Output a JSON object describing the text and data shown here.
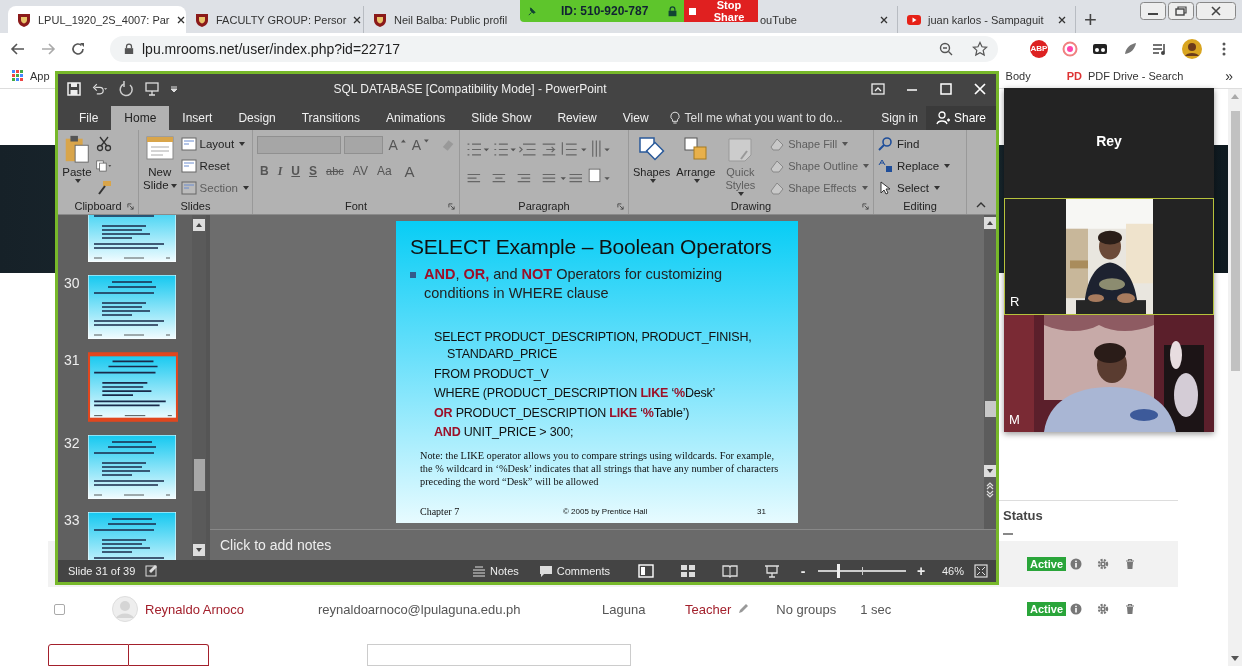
{
  "browser": {
    "tabs": [
      {
        "title": "LPUL_1920_2S_4007: Par",
        "selected": true
      },
      {
        "title": "FACULTY GROUP: Persor",
        "selected": false
      },
      {
        "title": "Neil Balba: Public profil",
        "selected": false
      },
      {
        "title": "ouTube",
        "selected": false
      },
      {
        "title": "juan karlos - Sampaguit",
        "selected": false
      }
    ],
    "new_tab": "+",
    "url": "lpu.mrooms.net/user/index.php?id=22717",
    "extension_badge": "ABP",
    "bookmarks": [
      "App",
      "Body",
      "PDF Drive - Search"
    ],
    "bookmark_badge": "PD",
    "bookmarks_more": "»"
  },
  "screen_share": {
    "meeting_id": "ID: 510-920-787",
    "stop": "Stop Share"
  },
  "powerpoint": {
    "title": "SQL DATABASE [Compatibility Mode] - PowerPoint",
    "tabs": [
      {
        "label": "File",
        "selected": false
      },
      {
        "label": "Home",
        "selected": true
      },
      {
        "label": "Insert",
        "selected": false
      },
      {
        "label": "Design",
        "selected": false
      },
      {
        "label": "Transitions",
        "selected": false
      },
      {
        "label": "Animations",
        "selected": false
      },
      {
        "label": "Slide Show",
        "selected": false
      },
      {
        "label": "Review",
        "selected": false
      },
      {
        "label": "View",
        "selected": false
      }
    ],
    "tell_me": "Tell me what you want to do...",
    "sign_in": "Sign in",
    "share": "Share",
    "ribbon": {
      "clipboard": {
        "label": "Clipboard",
        "paste": "Paste"
      },
      "slides": {
        "label": "Slides",
        "new_slide": [
          "New",
          "Slide"
        ],
        "items": [
          {
            "label": "Layout",
            "disabled": false
          },
          {
            "label": "Reset",
            "disabled": false
          },
          {
            "label": "Section",
            "disabled": true
          }
        ]
      },
      "font": {
        "label": "Font",
        "grow": "A",
        "shrink": "A",
        "buttons": [
          "B",
          "I",
          "U",
          "S",
          "abc",
          "AV",
          "Aa",
          "A"
        ]
      },
      "paragraph": {
        "label": "Paragraph"
      },
      "drawing": {
        "label": "Drawing",
        "large": [
          {
            "label": "Shapes",
            "disabled": false
          },
          {
            "label": "Arrange",
            "disabled": false
          },
          {
            "label": "Quick Styles",
            "disabled": true
          }
        ],
        "items": [
          {
            "label": "Shape Fill",
            "disabled": true
          },
          {
            "label": "Shape Outline",
            "disabled": true
          },
          {
            "label": "Shape Effects",
            "disabled": true
          }
        ]
      },
      "editing": {
        "label": "Editing",
        "items": [
          "Find",
          "Replace",
          "Select"
        ]
      }
    },
    "thumbnails": [
      {
        "selected": false
      },
      {
        "number": "30",
        "selected": false
      },
      {
        "number": "31",
        "selected": true
      },
      {
        "number": "32",
        "selected": false
      },
      {
        "number": "33",
        "selected": false
      }
    ],
    "slide": {
      "title": "SELECT Example – Boolean Operators",
      "bullet": "**AND**, **OR,** and **NOT** Operators for customizing conditions in WHERE clause",
      "code": [
        {
          "text": "SELECT PRODUCT_DESCRIPTION, PRODUCT_FINISH,",
          "indent": false
        },
        {
          "text": "STANDARD_PRICE",
          "indent": true
        },
        {
          "text": "FROM PRODUCT_V",
          "indent": false
        },
        {
          "text": "WHERE (PRODUCT_DESCRIPTION **LIKE** ‘**%**Desk’",
          "indent": false
        },
        {
          "text": "**OR** PRODUCT_DESCRIPTION **LIKE** ‘**%**Table’)",
          "indent": false
        },
        {
          "text": "**AND** UNIT_PRICE > 300;",
          "indent": false
        }
      ],
      "note": "Note: the LIKE operator allows you to compare strings using wildcards. For example, the % wildcard in ‘%Desk’  indicates that all strings that have any number of characters preceding the word “Desk” will be allowed",
      "chapter": "Chapter 7",
      "copyright": "© 2005 by Prentice Hall",
      "page": "31"
    },
    "notes_placeholder": "Click to add notes",
    "status": {
      "slide": "Slide 31 of 39",
      "notes": "Notes",
      "comments": "Comments",
      "zoom_out": "-",
      "zoom_in": "+",
      "zoom": "46%",
      "level": 0.23
    }
  },
  "meeting": {
    "speaker": "Rey",
    "videos": [
      {
        "label": "R",
        "selected": true
      },
      {
        "label": "M",
        "selected": false
      }
    ]
  },
  "users_table": {
    "status_header": "Status",
    "rows": [
      {
        "status": "Active",
        "selected": true
      },
      {
        "name": "Reynaldo Arnoco",
        "email": "reynaldoarnoco@lpulaguna.edu.ph",
        "city": "Laguna",
        "role": "Teacher",
        "groups": "No groups",
        "last_access": "1 sec",
        "status": "Active",
        "selected": false
      }
    ]
  }
}
